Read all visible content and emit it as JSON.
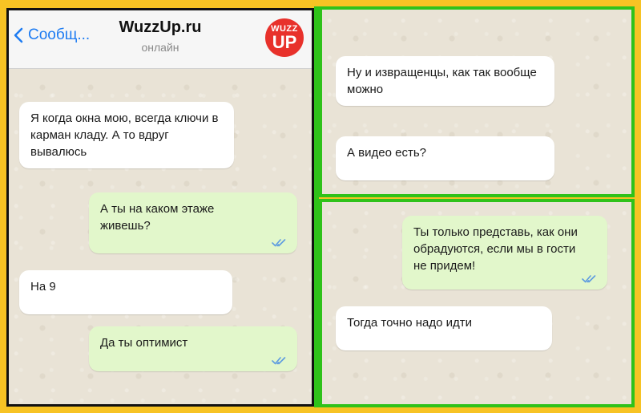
{
  "header": {
    "back_label": "Сообщ...",
    "title": "WuzzUp.ru",
    "status": "онлайн",
    "logo_top": "WUZZ",
    "logo_bottom": "UP"
  },
  "colors": {
    "frame": "#f7c324",
    "divider": "#2fc21a",
    "incoming": "#ffffff",
    "outgoing": "#e2f7cb",
    "accent": "#1e7cf2",
    "logo": "#e8312b"
  },
  "chat_left": [
    {
      "side": "in",
      "text": "Я когда окна мою, всегда ключи в карман кладу. А то вдруг вывалюсь"
    },
    {
      "side": "out",
      "text": "А ты на каком этаже живешь?",
      "read": true
    },
    {
      "side": "in",
      "text": "На 9"
    },
    {
      "side": "out",
      "text": "Да ты оптимист",
      "read": true
    }
  ],
  "chat_top_right": [
    {
      "side": "in",
      "text": "Ну и извращенцы, как так вообще можно"
    },
    {
      "side": "in",
      "text": "А видео есть?"
    }
  ],
  "chat_bottom_right": [
    {
      "side": "out",
      "text": "Ты только представь, как они обрадуются, если мы в гости не придем!",
      "read": true
    },
    {
      "side": "in",
      "text": "Тогда точно надо идти"
    }
  ]
}
